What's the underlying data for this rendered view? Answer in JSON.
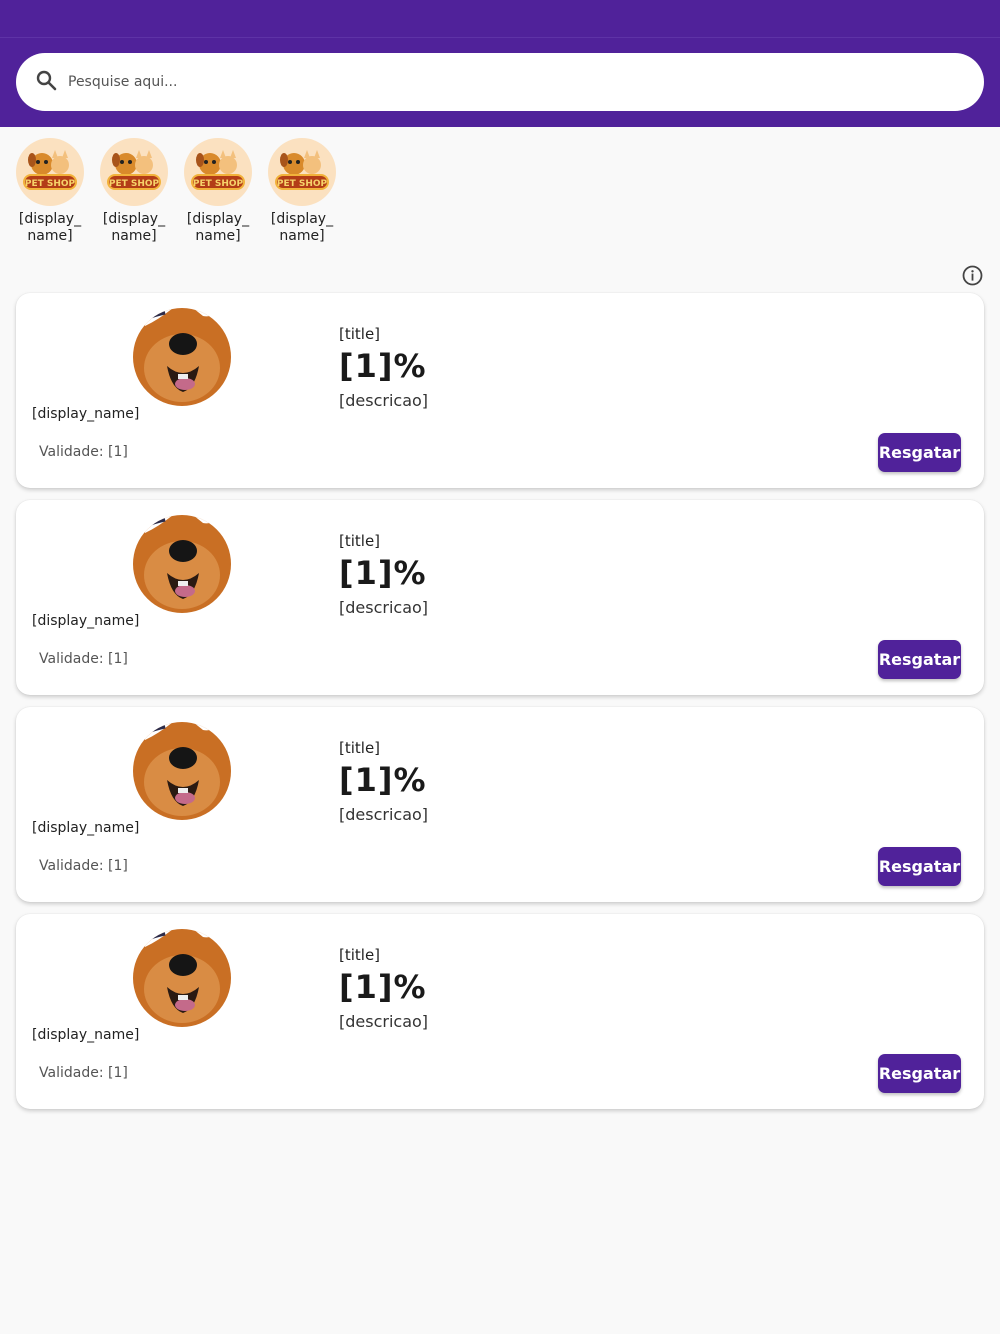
{
  "search": {
    "placeholder": "Pesquise aqui..."
  },
  "stores": [
    {
      "label": "[display_ name]",
      "logo_text": "PET SHOP"
    },
    {
      "label": "[display_ name]",
      "logo_text": "PET SHOP"
    },
    {
      "label": "[display_ name]",
      "logo_text": "PET SHOP"
    },
    {
      "label": "[display_ name]",
      "logo_text": "PET SHOP"
    }
  ],
  "coupons": [
    {
      "store": "[display_name]",
      "title": "[title]",
      "percent": "[1]%",
      "description": "[descricao]",
      "validity": "Validade: [1]",
      "button": "Resgatar"
    },
    {
      "store": "[display_name]",
      "title": "[title]",
      "percent": "[1]%",
      "description": "[descricao]",
      "validity": "Validade: [1]",
      "button": "Resgatar"
    },
    {
      "store": "[display_name]",
      "title": "[title]",
      "percent": "[1]%",
      "description": "[descricao]",
      "validity": "Validade: [1]",
      "button": "Resgatar"
    },
    {
      "store": "[display_name]",
      "title": "[title]",
      "percent": "[1]%",
      "description": "[descricao]",
      "validity": "Validade: [1]",
      "button": "Resgatar"
    }
  ],
  "colors": {
    "primary": "#50229a",
    "background": "#f9f9f9",
    "store_bg": "#fbe1c0"
  },
  "icons": {
    "search": "search-icon",
    "info": "info-icon"
  }
}
